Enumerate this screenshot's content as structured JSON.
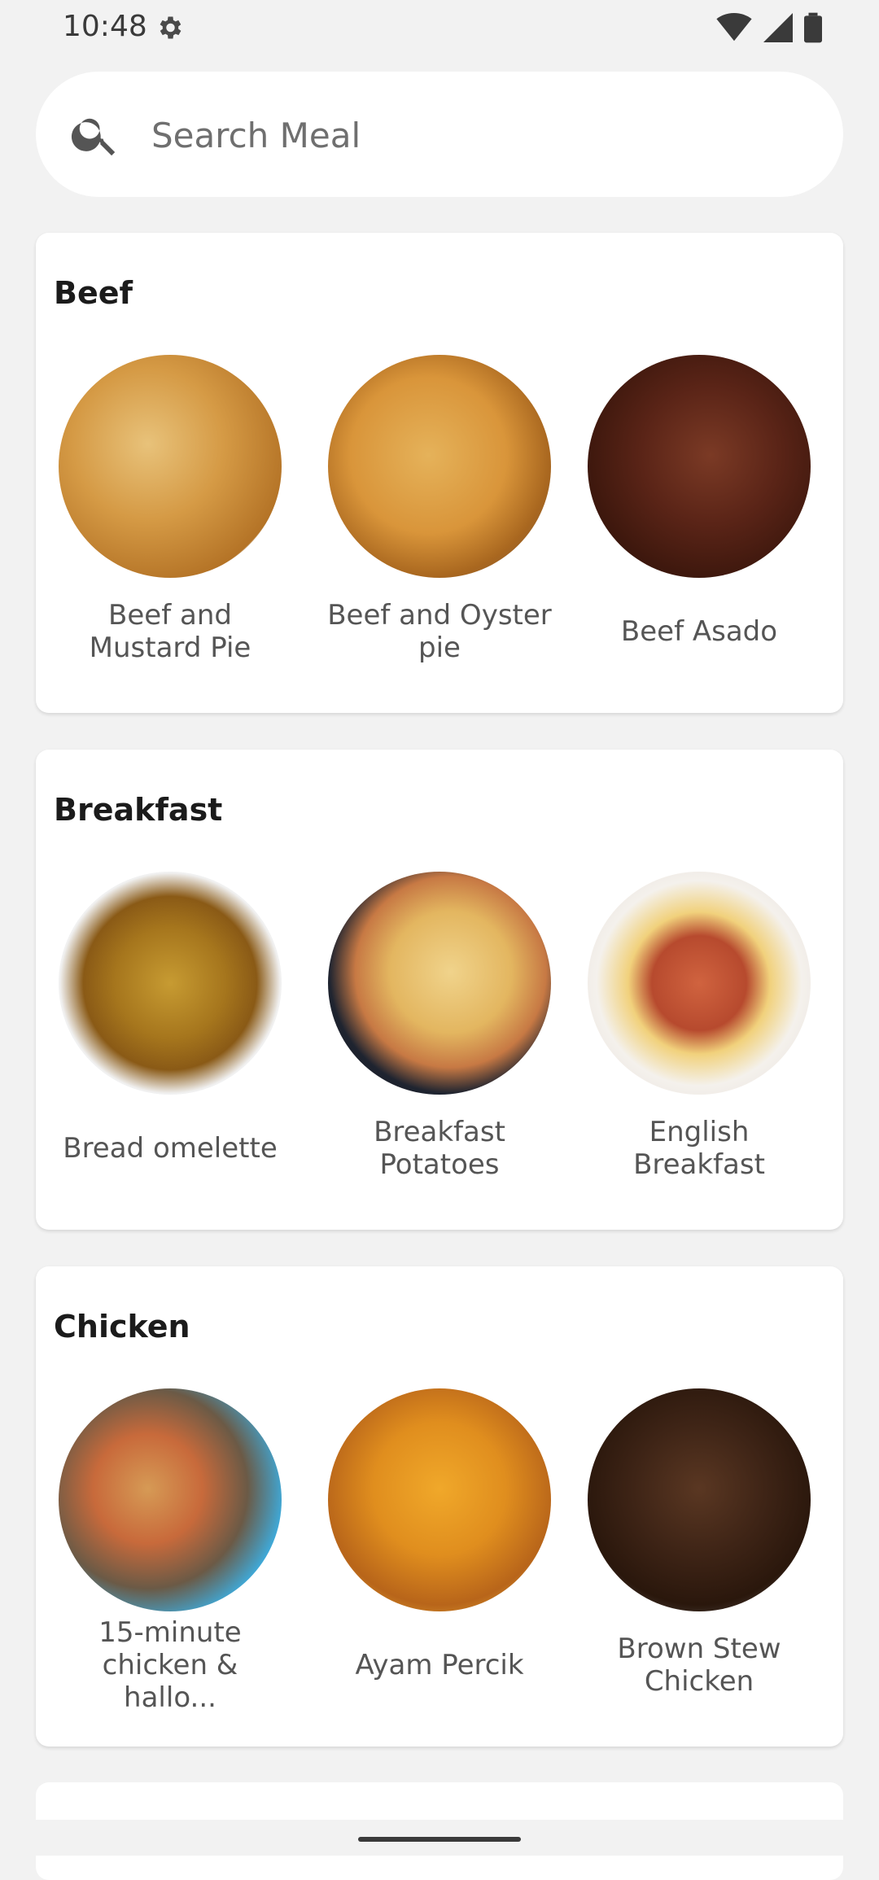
{
  "status_bar": {
    "time": "10:48",
    "icons": [
      "gear-icon",
      "wifi-icon",
      "signal-icon",
      "battery-icon"
    ]
  },
  "search": {
    "placeholder": "Search Meal",
    "value": ""
  },
  "categories": [
    {
      "title": "Beef",
      "meals": [
        {
          "name": "Beef and Mustard Pie"
        },
        {
          "name": "Beef and Oyster pie"
        },
        {
          "name": "Beef Asado"
        }
      ]
    },
    {
      "title": "Breakfast",
      "meals": [
        {
          "name": "Bread omelette"
        },
        {
          "name": "Breakfast Potatoes"
        },
        {
          "name": "English Breakfast"
        }
      ]
    },
    {
      "title": "Chicken",
      "meals": [
        {
          "name": "15-minute chicken & hallo..."
        },
        {
          "name": "Ayam Percik"
        },
        {
          "name": "Brown Stew Chicken"
        }
      ]
    }
  ],
  "colors": {
    "background": "#f2f2f2",
    "card": "#ffffff",
    "title_text": "#1b1b1b",
    "meal_text": "#555555"
  }
}
